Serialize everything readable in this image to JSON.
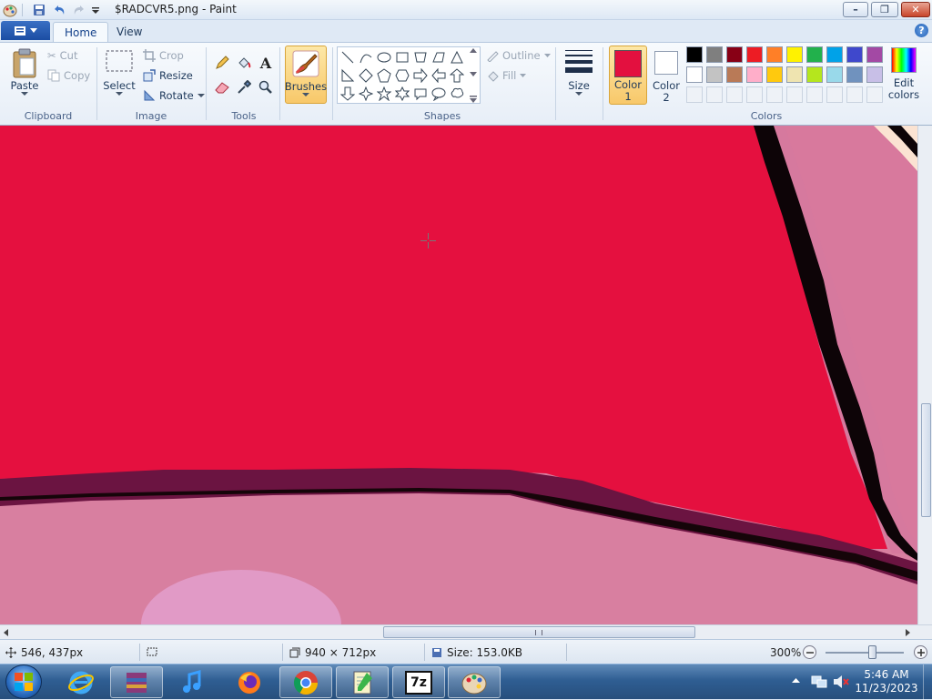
{
  "window": {
    "title": "$RADCVR5.png - Paint",
    "controls": {
      "minimize": "–",
      "maximize": "❐",
      "close": "✕"
    }
  },
  "tabs": {
    "home": "Home",
    "view": "View"
  },
  "ribbon": {
    "clipboard": {
      "label": "Clipboard",
      "paste": "Paste",
      "cut": "Cut",
      "copy": "Copy"
    },
    "image": {
      "label": "Image",
      "select": "Select",
      "crop": "Crop",
      "resize": "Resize",
      "rotate": "Rotate"
    },
    "tools": {
      "label": "Tools"
    },
    "brushes": {
      "label": "Brushes"
    },
    "shapes": {
      "label": "Shapes",
      "outline": "Outline",
      "fill": "Fill"
    },
    "size": {
      "label": "Size"
    },
    "colors": {
      "label": "Colors",
      "color1": "Color 1",
      "color2": "Color 2",
      "edit": "Edit colors",
      "color1_value": "#e3103f",
      "color2_value": "#ffffff",
      "palette_row1": [
        "#000000",
        "#7f7f7f",
        "#880015",
        "#ed1c24",
        "#ff7f27",
        "#fff200",
        "#22b14c",
        "#00a2e8",
        "#3f48cc",
        "#a349a4"
      ],
      "palette_row2": [
        "#ffffff",
        "#c3c3c3",
        "#b97a57",
        "#ffaec9",
        "#ffc90e",
        "#efe4b0",
        "#b5e61d",
        "#99d9ea",
        "#7092be",
        "#c8bfe7"
      ]
    }
  },
  "status": {
    "cursor_pos": "546, 437px",
    "dimensions": "940 × 712px",
    "size": "Size: 153.0KB",
    "zoom": "300%",
    "zoom_level": 0.6
  },
  "taskbar": {
    "time": "5:46 AM",
    "date": "11/23/2023"
  }
}
